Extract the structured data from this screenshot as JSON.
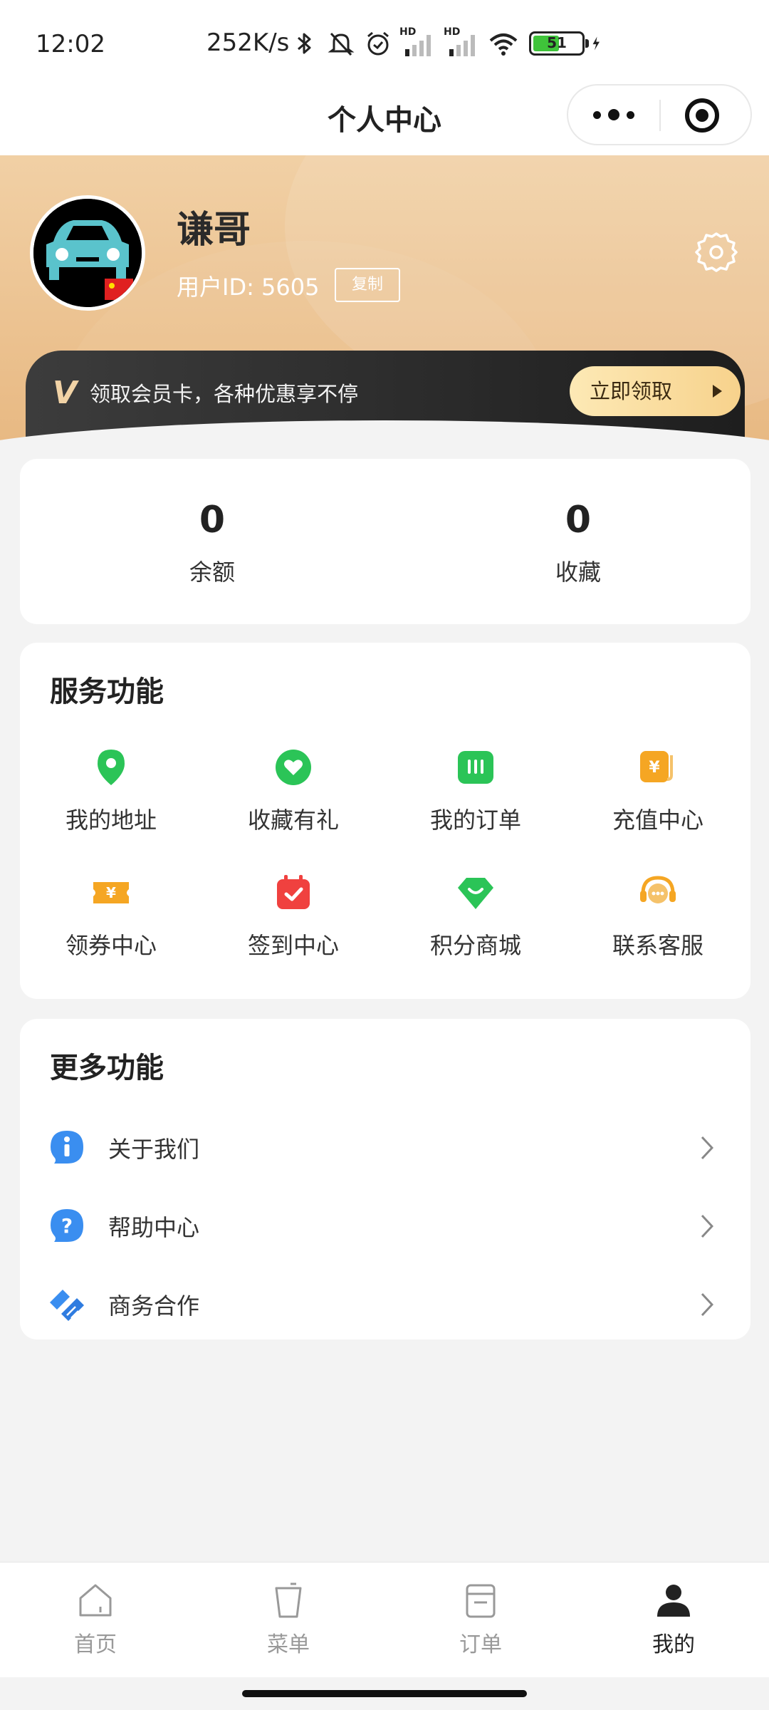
{
  "status_bar": {
    "time": "12:02",
    "speed": "252K/s",
    "hd": "HD",
    "battery": "51"
  },
  "navbar": {
    "title": "个人中心"
  },
  "profile": {
    "username": "谦哥",
    "user_id": "用户ID: 5605",
    "copy_label": "复制"
  },
  "vip": {
    "badge": "V",
    "text": "领取会员卡，各种优惠享不停",
    "button": "立即领取"
  },
  "stats": [
    {
      "value": "0",
      "label": "余额"
    },
    {
      "value": "0",
      "label": "收藏"
    }
  ],
  "services": {
    "title": "服务功能",
    "items": [
      {
        "label": "我的地址",
        "icon": "location-pin-icon",
        "color": "#2bc457"
      },
      {
        "label": "收藏有礼",
        "icon": "heart-icon",
        "color": "#2bc457"
      },
      {
        "label": "我的订单",
        "icon": "order-ticket-icon",
        "color": "#2bc457"
      },
      {
        "label": "充值中心",
        "icon": "recharge-icon",
        "color": "#f5a623"
      },
      {
        "label": "领券中心",
        "icon": "coupon-icon",
        "color": "#f5a623"
      },
      {
        "label": "签到中心",
        "icon": "calendar-check-icon",
        "color": "#f0413f"
      },
      {
        "label": "积分商城",
        "icon": "shopping-tag-icon",
        "color": "#2bc457"
      },
      {
        "label": "联系客服",
        "icon": "headset-icon",
        "color": "#f5a623"
      }
    ]
  },
  "more": {
    "title": "更多功能",
    "items": [
      {
        "label": "关于我们",
        "icon": "info-icon"
      },
      {
        "label": "帮助中心",
        "icon": "help-icon"
      },
      {
        "label": "商务合作",
        "icon": "handshake-icon"
      }
    ]
  },
  "tabbar": {
    "items": [
      {
        "label": "首页",
        "icon": "home-icon",
        "active": false
      },
      {
        "label": "菜单",
        "icon": "cup-icon",
        "active": false
      },
      {
        "label": "订单",
        "icon": "order-icon",
        "active": false
      },
      {
        "label": "我的",
        "icon": "user-icon",
        "active": true
      }
    ]
  },
  "colors": {
    "accent_gold": "#e8b983",
    "green": "#2bc457",
    "orange": "#f5a623",
    "red": "#f0413f",
    "blue": "#3a8ef0"
  }
}
